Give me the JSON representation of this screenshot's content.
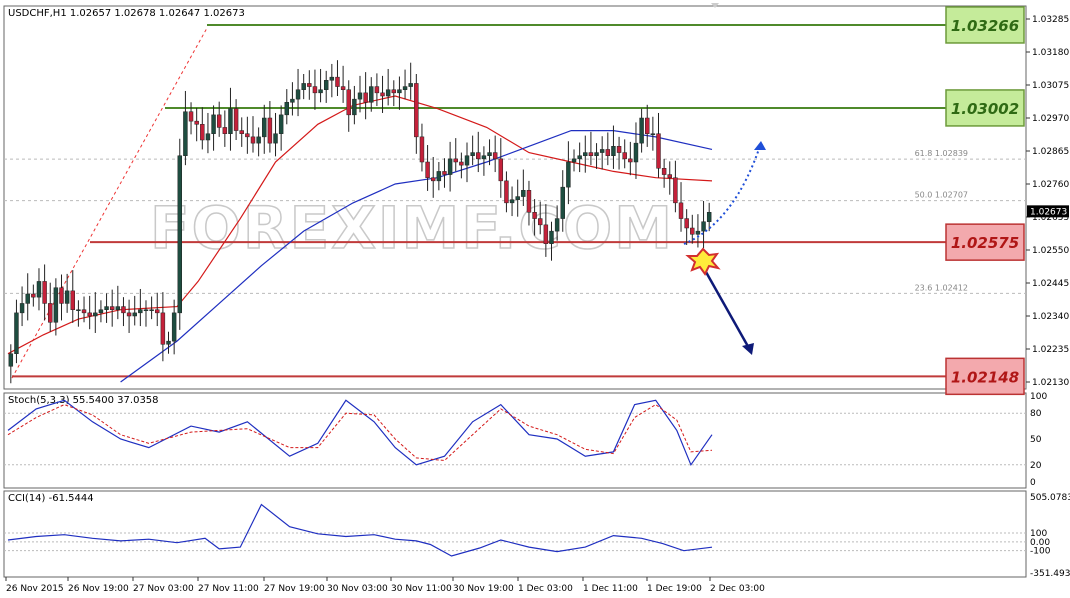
{
  "header": {
    "main": "USDCHF,H1  1.02657 1.02678 1.02647 1.02673"
  },
  "indicators": {
    "stoch": "Stoch(5,3,3) 55.5400 37.0358",
    "cci": "CCI(14) -61.5444"
  },
  "watermark": "FOREXIMF.COM",
  "colors": {
    "bull": "#1e4d40",
    "bear": "#c4213a",
    "ma_red": "#d41a1a",
    "ma_blue": "#1f2fc0",
    "resistance": "#4f8a2b",
    "support": "#c03a3a",
    "res_box": "#c5eb9a",
    "sup_box": "#f3a9ad",
    "arrow_up": "#1f4fd8",
    "arrow_down": "#0e1a78"
  },
  "levels": [
    {
      "label": "1.03266",
      "kind": "resistance"
    },
    {
      "label": "1.03002",
      "kind": "resistance"
    },
    {
      "label": "1.02575",
      "kind": "support"
    },
    {
      "label": "1.02148",
      "kind": "support"
    }
  ],
  "fib": [
    {
      "label": "61.8  1.02839",
      "value": 1.02839
    },
    {
      "label": "50.0  1.02707",
      "value": 1.02707
    },
    {
      "label": "23.6  1.02412",
      "value": 1.02412
    }
  ],
  "chart_data": {
    "type": "candlestick",
    "symbol": "USDCHF",
    "timeframe": "H1",
    "price_axis": {
      "ylim": [
        1.0205,
        1.0332
      ],
      "ticks": [
        "1.03285",
        "1.03180",
        "1.03075",
        "1.02970",
        "1.02865",
        "1.02760",
        "1.02655",
        "1.02550",
        "1.02445",
        "1.02340",
        "1.02235",
        "1.02130"
      ],
      "current": "1.02673"
    },
    "x_labels": [
      "26 Nov 2015",
      "26 Nov 19:00",
      "27 Nov 03:00",
      "27 Nov 11:00",
      "27 Nov 19:00",
      "30 Nov 03:00",
      "30 Nov 11:00",
      "30 Nov 19:00",
      "1 Dec 03:00",
      "1 Dec 11:00",
      "1 Dec 19:00",
      "2 Dec 03:00"
    ],
    "closes": [
      1.0222,
      1.0235,
      1.0238,
      1.0241,
      1.024,
      1.0245,
      1.0238,
      1.0232,
      1.0243,
      1.0238,
      1.0242,
      1.0236,
      1.0236,
      1.0235,
      1.0234,
      1.0235,
      1.0236,
      1.0237,
      1.0236,
      1.0237,
      1.0235,
      1.0234,
      1.0235,
      1.0236,
      1.0236,
      1.0236,
      1.0235,
      1.0225,
      1.0226,
      1.0235,
      1.0285,
      1.0299,
      1.0296,
      1.0295,
      1.029,
      1.0292,
      1.0298,
      1.0294,
      1.0292,
      1.03,
      1.0293,
      1.0292,
      1.0291,
      1.0289,
      1.0291,
      1.0297,
      1.0289,
      1.0292,
      1.0298,
      1.0302,
      1.0303,
      1.0306,
      1.0308,
      1.0307,
      1.0305,
      1.0306,
      1.0309,
      1.031,
      1.0307,
      1.0306,
      1.0298,
      1.0303,
      1.0305,
      1.0302,
      1.0307,
      1.0305,
      1.0304,
      1.0306,
      1.0305,
      1.0306,
      1.0307,
      1.0308,
      1.0291,
      1.0283,
      1.0278,
      1.0277,
      1.028,
      1.0279,
      1.0284,
      1.0283,
      1.0282,
      1.0285,
      1.0286,
      1.0284,
      1.0285,
      1.0286,
      1.0284,
      1.0277,
      1.027,
      1.0271,
      1.0272,
      1.0274,
      1.0267,
      1.0265,
      1.0263,
      1.0257,
      1.0261,
      1.0265,
      1.0275,
      1.0283,
      1.0284,
      1.0285,
      1.0286,
      1.0285,
      1.0286,
      1.0287,
      1.0285,
      1.0288,
      1.0286,
      1.0284,
      1.0283,
      1.0289,
      1.0297,
      1.0292,
      1.0292,
      1.0281,
      1.0279,
      1.0278,
      1.027,
      1.0265,
      1.0262,
      1.026,
      1.0261,
      1.0264,
      1.0267
    ],
    "ma_red": [
      [
        0,
        1.0222
      ],
      [
        0.05,
        1.0228
      ],
      [
        0.1,
        1.0233
      ],
      [
        0.16,
        1.0236
      ],
      [
        0.24,
        1.0237
      ],
      [
        0.27,
        1.0245
      ],
      [
        0.33,
        1.0265
      ],
      [
        0.38,
        1.0283
      ],
      [
        0.44,
        1.0295
      ],
      [
        0.49,
        1.0301
      ],
      [
        0.55,
        1.0304
      ],
      [
        0.61,
        1.03
      ],
      [
        0.68,
        1.0294
      ],
      [
        0.74,
        1.0286
      ],
      [
        0.8,
        1.0283
      ],
      [
        0.86,
        1.028
      ],
      [
        0.92,
        1.0278
      ],
      [
        1.0,
        1.0277
      ]
    ],
    "ma_blue": [
      [
        0.16,
        1.0213
      ],
      [
        0.24,
        1.0226
      ],
      [
        0.3,
        1.0238
      ],
      [
        0.36,
        1.025
      ],
      [
        0.42,
        1.0261
      ],
      [
        0.49,
        1.027
      ],
      [
        0.55,
        1.0276
      ],
      [
        0.61,
        1.0278
      ],
      [
        0.68,
        1.0283
      ],
      [
        0.74,
        1.0288
      ],
      [
        0.8,
        1.0293
      ],
      [
        0.86,
        1.0293
      ],
      [
        0.92,
        1.0291
      ],
      [
        1.0,
        1.0287
      ]
    ],
    "stoch_main": [
      [
        0,
        60
      ],
      [
        0.04,
        85
      ],
      [
        0.08,
        95
      ],
      [
        0.12,
        70
      ],
      [
        0.16,
        50
      ],
      [
        0.2,
        40
      ],
      [
        0.26,
        65
      ],
      [
        0.3,
        58
      ],
      [
        0.34,
        70
      ],
      [
        0.4,
        30
      ],
      [
        0.44,
        45
      ],
      [
        0.48,
        95
      ],
      [
        0.52,
        70
      ],
      [
        0.55,
        40
      ],
      [
        0.58,
        20
      ],
      [
        0.62,
        30
      ],
      [
        0.66,
        70
      ],
      [
        0.7,
        90
      ],
      [
        0.74,
        55
      ],
      [
        0.78,
        50
      ],
      [
        0.82,
        30
      ],
      [
        0.86,
        35
      ],
      [
        0.89,
        90
      ],
      [
        0.92,
        95
      ],
      [
        0.95,
        60
      ],
      [
        0.97,
        20
      ],
      [
        1.0,
        55
      ]
    ],
    "stoch_signal": [
      [
        0,
        55
      ],
      [
        0.04,
        75
      ],
      [
        0.08,
        90
      ],
      [
        0.12,
        78
      ],
      [
        0.16,
        55
      ],
      [
        0.2,
        45
      ],
      [
        0.26,
        58
      ],
      [
        0.3,
        60
      ],
      [
        0.34,
        62
      ],
      [
        0.4,
        40
      ],
      [
        0.44,
        40
      ],
      [
        0.48,
        80
      ],
      [
        0.52,
        78
      ],
      [
        0.55,
        50
      ],
      [
        0.58,
        28
      ],
      [
        0.62,
        25
      ],
      [
        0.66,
        55
      ],
      [
        0.7,
        85
      ],
      [
        0.74,
        65
      ],
      [
        0.78,
        55
      ],
      [
        0.82,
        38
      ],
      [
        0.86,
        33
      ],
      [
        0.89,
        75
      ],
      [
        0.92,
        90
      ],
      [
        0.95,
        72
      ],
      [
        0.97,
        35
      ],
      [
        1.0,
        37
      ]
    ],
    "stoch_levels": [
      "100",
      "80",
      "50",
      "20",
      "0"
    ],
    "cci": [
      [
        0,
        20
      ],
      [
        0.04,
        60
      ],
      [
        0.08,
        80
      ],
      [
        0.12,
        40
      ],
      [
        0.16,
        10
      ],
      [
        0.2,
        30
      ],
      [
        0.24,
        -10
      ],
      [
        0.28,
        40
      ],
      [
        0.3,
        -80
      ],
      [
        0.33,
        -60
      ],
      [
        0.36,
        420
      ],
      [
        0.4,
        170
      ],
      [
        0.44,
        90
      ],
      [
        0.48,
        60
      ],
      [
        0.52,
        80
      ],
      [
        0.55,
        30
      ],
      [
        0.58,
        10
      ],
      [
        0.6,
        -30
      ],
      [
        0.63,
        -160
      ],
      [
        0.67,
        -70
      ],
      [
        0.7,
        20
      ],
      [
        0.74,
        -60
      ],
      [
        0.78,
        -110
      ],
      [
        0.82,
        -60
      ],
      [
        0.86,
        70
      ],
      [
        0.9,
        40
      ],
      [
        0.93,
        -20
      ],
      [
        0.96,
        -100
      ],
      [
        1.0,
        -61
      ]
    ],
    "cci_levels": [
      "505.0783",
      "100",
      "0.00",
      "-100",
      "-351.4939"
    ]
  }
}
